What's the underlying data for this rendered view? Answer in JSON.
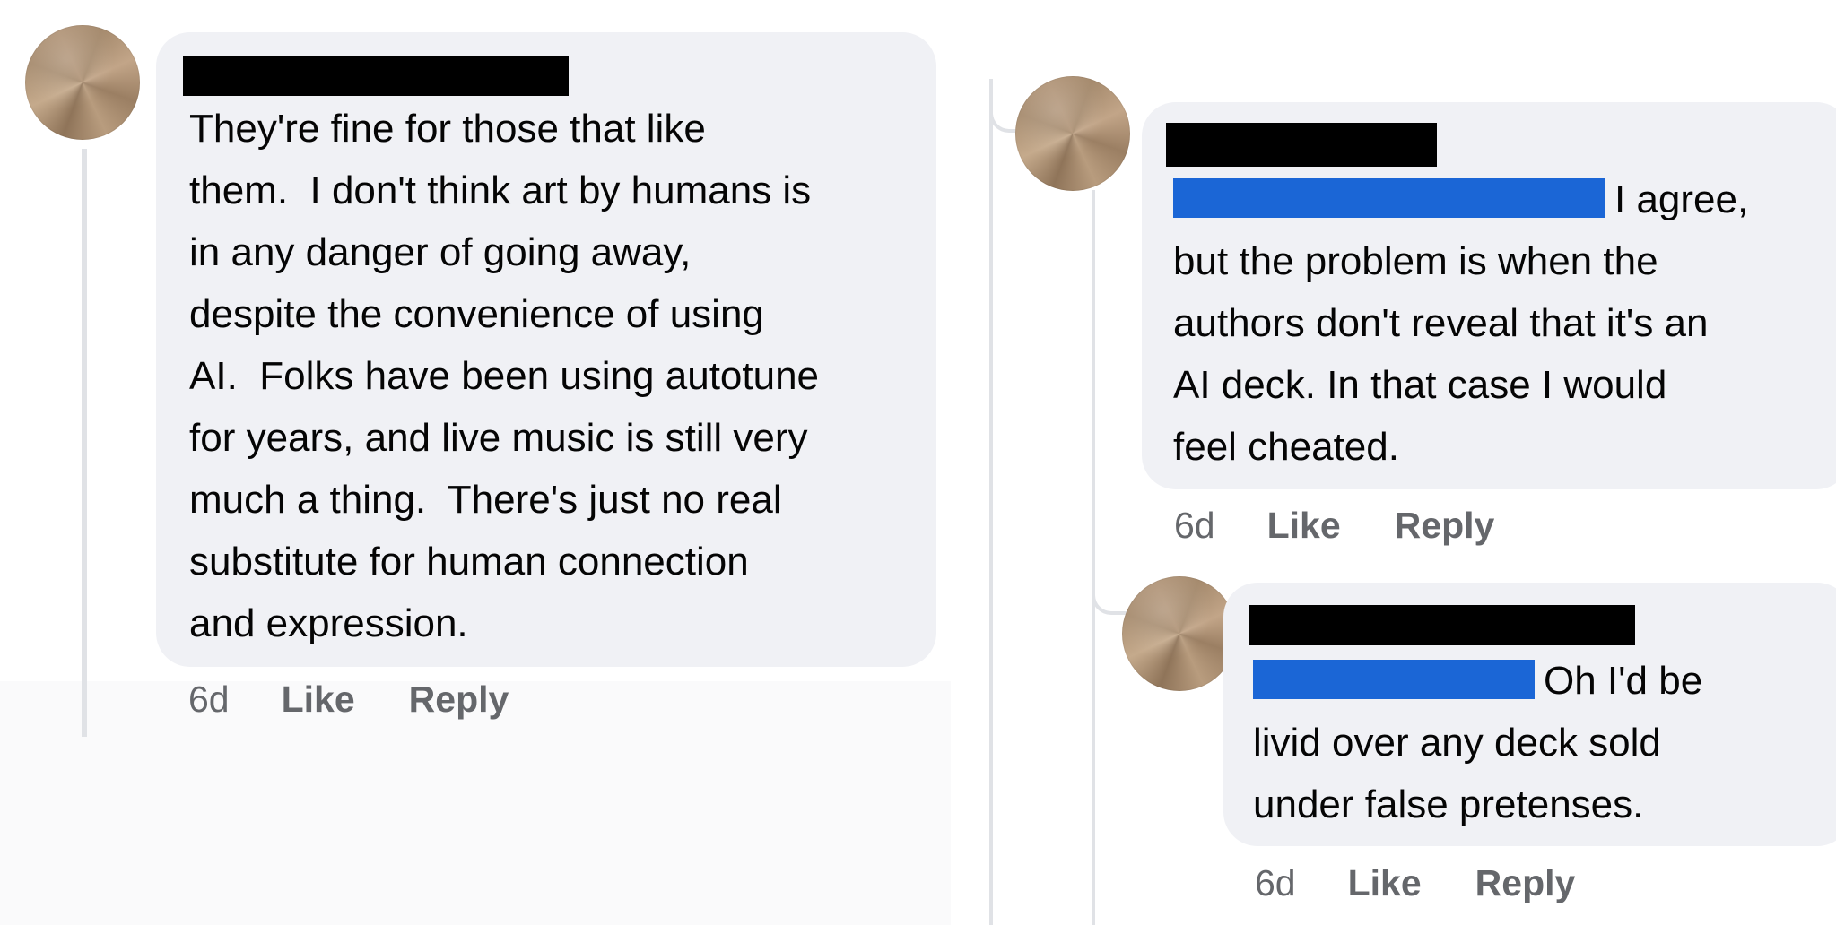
{
  "comments": [
    {
      "text": "They're fine for those that like\nthem.  I don't think art by humans is\nin any danger of going away,\ndespite the convenience of using\nAI.  Folks have been using autotune\nfor years, and live music is still very\nmuch a thing.  There's just no real\nsubstitute for human connection\nand expression.",
      "time": "6d",
      "like": "Like",
      "reply": "Reply"
    },
    {
      "text": "I agree,\nbut the problem is when the\nauthors don't reveal that it's an\nAI deck. In that case I would\nfeel cheated.",
      "time": "6d",
      "like": "Like",
      "reply": "Reply"
    },
    {
      "text": "Oh I'd be\nlivid over any deck sold\nunder false pretenses.",
      "time": "6d",
      "like": "Like",
      "reply": "Reply"
    }
  ],
  "colors": {
    "bubble": "#f0f1f5",
    "redaction": "#000000",
    "mention_highlight": "#1b66d6",
    "meta_text": "#65676b",
    "thread_line": "#e0e2e6"
  }
}
